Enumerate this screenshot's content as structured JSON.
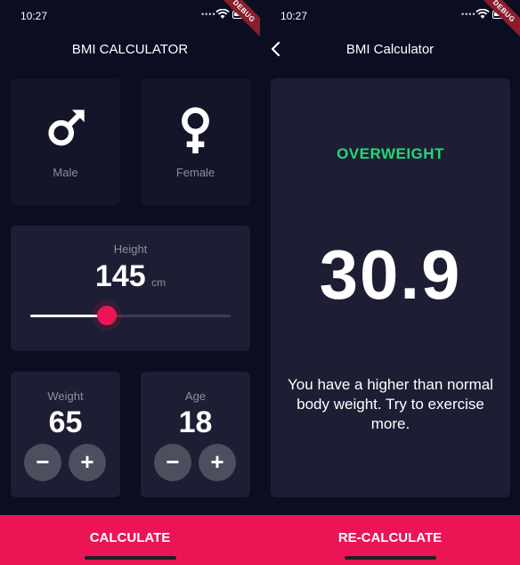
{
  "status_bar": {
    "time": "10:27",
    "badge": "DEBUG"
  },
  "input_screen": {
    "title": "BMI CALCULATOR",
    "gender": {
      "male": {
        "label": "Male",
        "icon": "male-symbol-icon"
      },
      "female": {
        "label": "Female",
        "icon": "female-symbol-icon"
      }
    },
    "height": {
      "label": "Height",
      "value": "145",
      "unit": "cm",
      "slider_fraction": 0.38
    },
    "weight": {
      "label": "Weight",
      "value": "65",
      "minus": "−",
      "plus": "+"
    },
    "age": {
      "label": "Age",
      "value": "18",
      "minus": "−",
      "plus": "+"
    },
    "calculate_label": "CALCULATE"
  },
  "result_screen": {
    "title": "BMI Calculator",
    "back_icon": "chevron-left-icon",
    "status": "OVERWEIGHT",
    "bmi": "30.9",
    "message": "You have a higher than normal body weight. Try to exercise more.",
    "recalculate_label": "RE-CALCULATE"
  },
  "colors": {
    "background": "#0b0d21",
    "card": "#1d1e33",
    "accent": "#eb1555",
    "result_green": "#24d876",
    "label_gray": "#8d8e98",
    "round_button": "#4c4f5e"
  }
}
